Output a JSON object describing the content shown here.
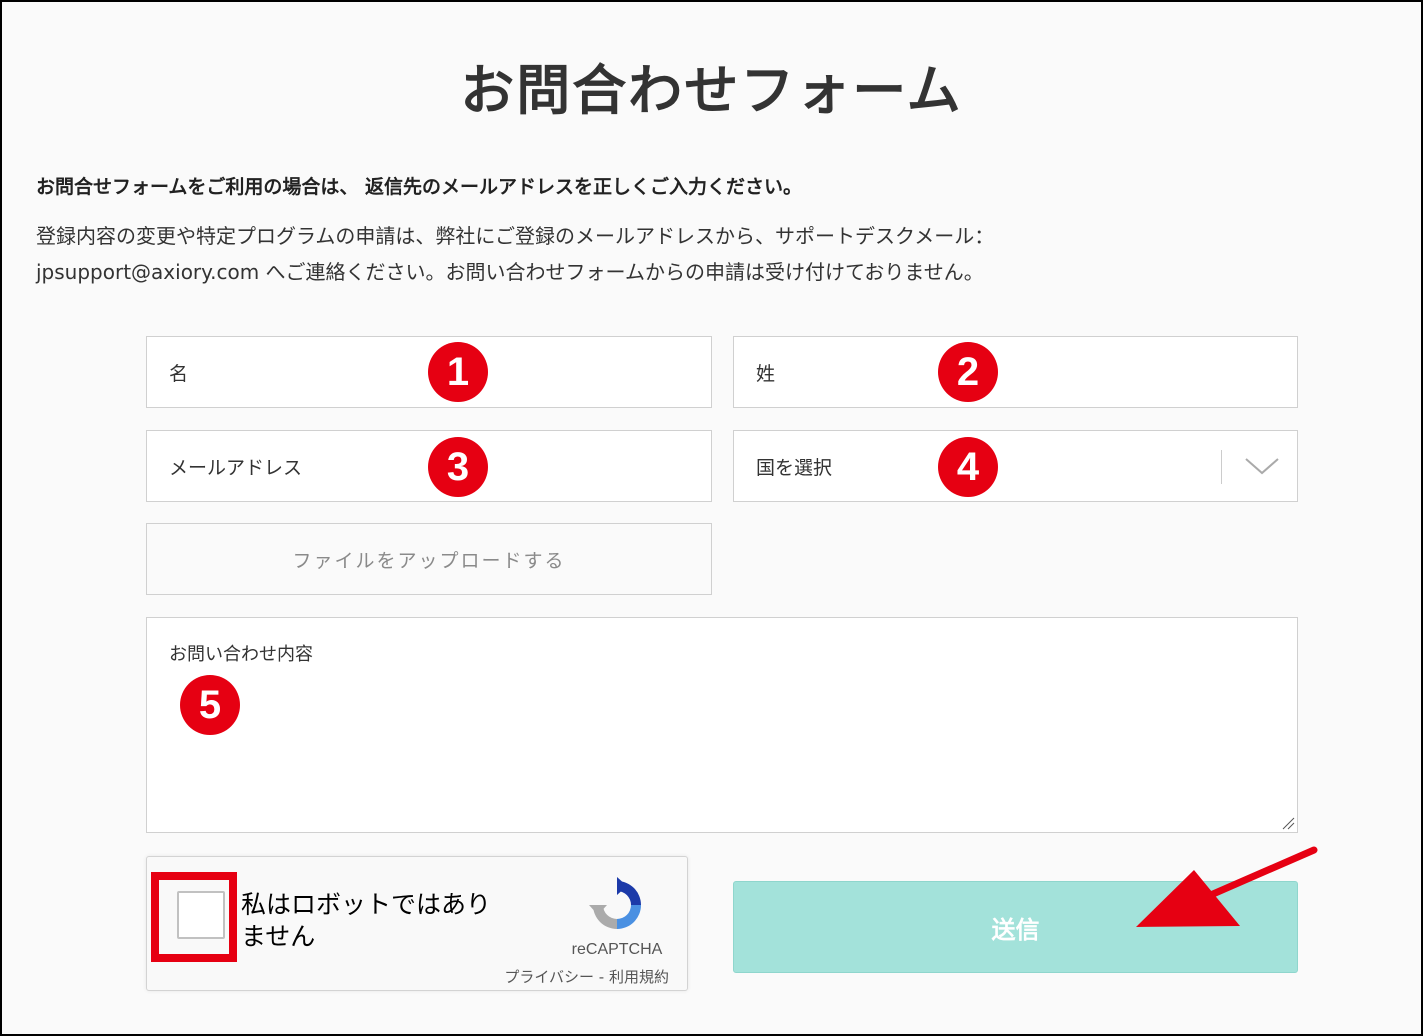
{
  "page": {
    "title": "お問合わせフォーム",
    "notice_bold": "お問合せフォームをご利用の場合は、 返信先のメールアドレスを正しくご入力ください。",
    "notice_line1": "登録内容の変更や特定プログラムの申請は、弊社にご登録のメールアドレスから、サポートデスクメール：",
    "notice_line2": "jpsupport@axiory.com へご連絡ください。お問い合わせフォームからの申請は受け付けておりません。"
  },
  "form": {
    "first_name_placeholder": "名",
    "last_name_placeholder": "姓",
    "email_placeholder": "メールアドレス",
    "country_placeholder": "国を選択",
    "upload_label": "ファイルをアップロードする",
    "message_placeholder": "お問い合わせ内容",
    "submit_label": "送信"
  },
  "recaptcha": {
    "label": "私はロボットではありません",
    "brand": "reCAPTCHA",
    "links": "プライバシー - 利用規約"
  },
  "annotations": {
    "badges": [
      "1",
      "2",
      "3",
      "4",
      "5"
    ],
    "badge_color": "#e60012",
    "highlight_color": "#e60012"
  },
  "colors": {
    "submit_bg": "#a3e2da",
    "accent_red": "#e60012"
  }
}
